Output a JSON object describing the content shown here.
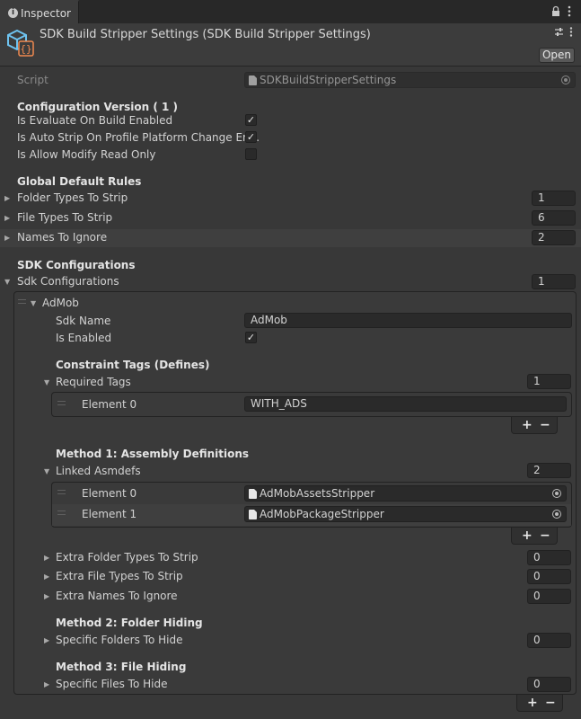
{
  "tab": {
    "label": "Inspector"
  },
  "header": {
    "title": "SDK Build Stripper Settings (SDK Build Stripper Settings)",
    "open_label": "Open"
  },
  "script_field": {
    "label": "Script",
    "value": "SDKBuildStripperSettings"
  },
  "config": {
    "heading": "Configuration Version ( 1 )",
    "rows": [
      {
        "label": "Is Evaluate On Build Enabled",
        "checked": true
      },
      {
        "label": "Is Auto Strip On Profile Platform Change En...",
        "checked": true
      },
      {
        "label": "Is Allow Modify Read Only",
        "checked": false
      }
    ]
  },
  "global": {
    "heading": "Global Default Rules",
    "rows": [
      {
        "label": "Folder Types To Strip",
        "value": "1"
      },
      {
        "label": "File Types To Strip",
        "value": "6"
      },
      {
        "label": "Names To Ignore",
        "value": "2"
      }
    ]
  },
  "sdk": {
    "heading": "SDK Configurations",
    "list_label": "Sdk Configurations",
    "count": "1",
    "element": {
      "title": "AdMob",
      "sdk_name_label": "Sdk Name",
      "sdk_name_value": "AdMob",
      "is_enabled_label": "Is Enabled",
      "is_enabled": true,
      "constraint_heading": "Constraint Tags (Defines)",
      "required_tags_label": "Required Tags",
      "required_tags_count": "1",
      "required_tags": [
        {
          "label": "Element 0",
          "value": "WITH_ADS"
        }
      ],
      "method1_heading": "Method 1: Assembly Definitions",
      "linked_label": "Linked Asmdefs",
      "linked_count": "2",
      "linked": [
        {
          "label": "Element 0",
          "value": "AdMobAssetsStripper"
        },
        {
          "label": "Element 1",
          "value": "AdMobPackageStripper"
        }
      ],
      "extra": [
        {
          "label": "Extra Folder Types To Strip",
          "value": "0"
        },
        {
          "label": "Extra File Types To Strip",
          "value": "0"
        },
        {
          "label": "Extra Names To Ignore",
          "value": "0"
        }
      ],
      "method2_heading": "Method 2: Folder Hiding",
      "folders_label": "Specific Folders To Hide",
      "folders_count": "0",
      "method3_heading": "Method 3: File Hiding",
      "files_label": "Specific Files To Hide",
      "files_count": "0"
    }
  },
  "plus_label": "+",
  "minus_label": "−",
  "fold_open": "▼",
  "fold_closed": "▶",
  "check_mark": "✓",
  "icons": {
    "tab": "info-icon",
    "lock": "lock-icon",
    "menu": "kebab-menu-icon",
    "asset": "scriptable-object-icon",
    "settings": "preset-icon",
    "field": "asset-file-icon",
    "picker": "object-picker-icon"
  },
  "colors": {
    "background": "#383838",
    "field": "#2a2a2a",
    "header": "#3c3c3c",
    "tab_bar": "#282828"
  }
}
